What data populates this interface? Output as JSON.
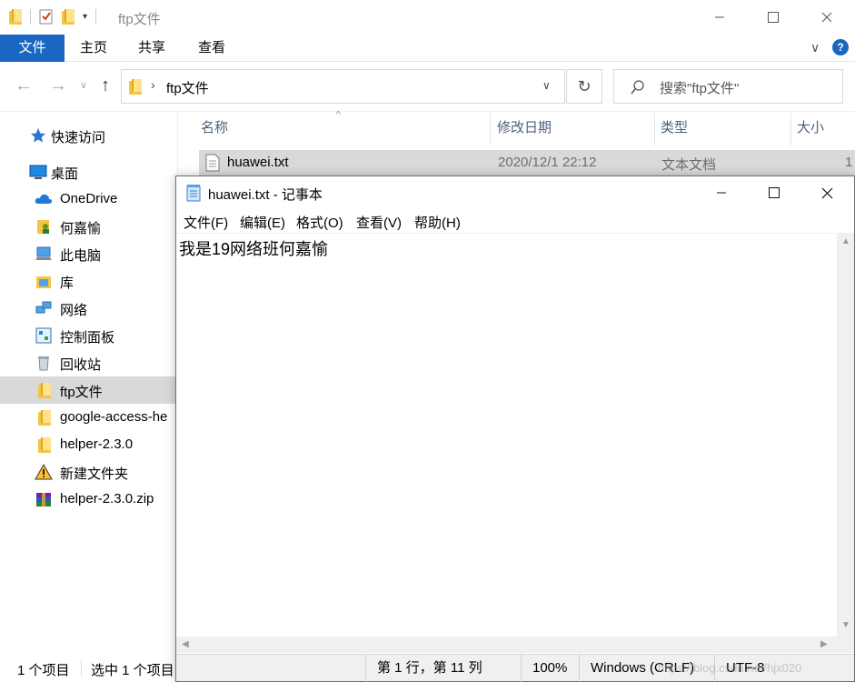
{
  "explorer": {
    "title": "ftp文件",
    "ribbon_tabs": [
      "文件",
      "主页",
      "共享",
      "查看"
    ],
    "address_path": "ftp文件",
    "search_placeholder": "搜索\"ftp文件\"",
    "sidebar": [
      {
        "label": "快速访问",
        "icon": "star-icon"
      },
      {
        "label": "桌面",
        "icon": "desktop-icon"
      },
      {
        "label": "OneDrive",
        "icon": "cloud-icon"
      },
      {
        "label": "何嘉愉",
        "icon": "user-folder-icon"
      },
      {
        "label": "此电脑",
        "icon": "computer-icon"
      },
      {
        "label": "库",
        "icon": "library-icon"
      },
      {
        "label": "网络",
        "icon": "network-icon"
      },
      {
        "label": "控制面板",
        "icon": "control-panel-icon"
      },
      {
        "label": "回收站",
        "icon": "recycle-bin-icon"
      },
      {
        "label": "ftp文件",
        "icon": "folder-icon"
      },
      {
        "label": "google-access-he",
        "icon": "folder-icon"
      },
      {
        "label": "helper-2.3.0",
        "icon": "folder-icon"
      },
      {
        "label": "新建文件夹",
        "icon": "warning-icon"
      },
      {
        "label": "helper-2.3.0.zip",
        "icon": "archive-icon"
      }
    ],
    "columns": [
      "名称",
      "修改日期",
      "类型",
      "大小"
    ],
    "files": [
      {
        "name": "huawei.txt",
        "modified": "2020/12/1 22:12",
        "type": "文本文档",
        "size": "1"
      }
    ],
    "status_count": "1 个项目",
    "status_selected": "选中 1 个项目"
  },
  "notepad": {
    "title": "huawei.txt - 记事本",
    "menu": [
      "文件(F)",
      "编辑(E)",
      "格式(O)",
      "查看(V)",
      "帮助(H)"
    ],
    "content": "我是19网络班何嘉愉",
    "status_position": "第 1 行，第 11 列",
    "status_zoom": "100%",
    "status_line_ending": "Windows (CRLF)",
    "status_encoding": "UTF-8",
    "watermark": "https://blog.csdn.net/hjx020"
  },
  "colors": {
    "accent": "#1a67c2",
    "selection": "#d9d9d9"
  }
}
